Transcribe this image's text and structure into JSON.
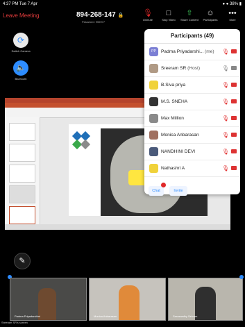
{
  "status_bar": {
    "time_date": "4:37 PM   Tue 7 Apr",
    "right": "● ● 38% ▮"
  },
  "top_bar": {
    "leave_label": "Leave Meeting",
    "meeting_id": "894-268-147",
    "password_label": "Password: 955977",
    "buttons": [
      {
        "label": "Unmute",
        "icon": "mic-muted-icon"
      },
      {
        "label": "Stop Video",
        "icon": "video-icon"
      },
      {
        "label": "Share Content",
        "icon": "share-icon"
      },
      {
        "label": "Participants",
        "icon": "participants-icon"
      },
      {
        "label": "More",
        "icon": "more-icon"
      }
    ]
  },
  "side_controls": {
    "switch_camera": "Switch Camera",
    "bluetooth": "Bluetooth"
  },
  "participants": {
    "title": "Participants (49)",
    "list": [
      {
        "initials": "PP",
        "name": "Padma Priyadarshi...",
        "tag": "(me)",
        "avatar_color": "#7b7fd4",
        "mic": "muted",
        "cam": "off"
      },
      {
        "initials": "",
        "name": "Sreeram SR",
        "tag": "(Host)",
        "avatar_color": "#b09a85",
        "mic": "on",
        "cam": "on"
      },
      {
        "initials": "",
        "name": "B.Siva priya",
        "tag": "",
        "avatar_color": "#f0d23a",
        "mic": "muted",
        "cam": "off"
      },
      {
        "initials": "",
        "name": "M.S. SNEHA",
        "tag": "",
        "avatar_color": "#333333",
        "mic": "muted",
        "cam": "off"
      },
      {
        "initials": "",
        "name": "Max Million",
        "tag": "",
        "avatar_color": "#8a8a8a",
        "mic": "muted",
        "cam": "off"
      },
      {
        "initials": "",
        "name": "Monica Anbarasan",
        "tag": "",
        "avatar_color": "#a07060",
        "mic": "muted",
        "cam": "off"
      },
      {
        "initials": "",
        "name": "NANDHINI DEVI",
        "tag": "",
        "avatar_color": "#4a5a7a",
        "mic": "muted",
        "cam": "off"
      },
      {
        "initials": "",
        "name": "Nathashri A",
        "tag": "",
        "avatar_color": "#f0d23a",
        "mic": "muted",
        "cam": "off"
      }
    ],
    "chat_label": "Chat",
    "invite_label": "Invite"
  },
  "gallery": [
    {
      "name": "Padma Priyadarshini"
    },
    {
      "name": "Monica Anbarasan"
    },
    {
      "name": "Saraswathy Selvam"
    }
  ],
  "speaking_label": "Sreeram SR's screen",
  "colors": {
    "accent": "#2d8cff",
    "danger": "#e02828",
    "ppt": "#c4502f"
  }
}
